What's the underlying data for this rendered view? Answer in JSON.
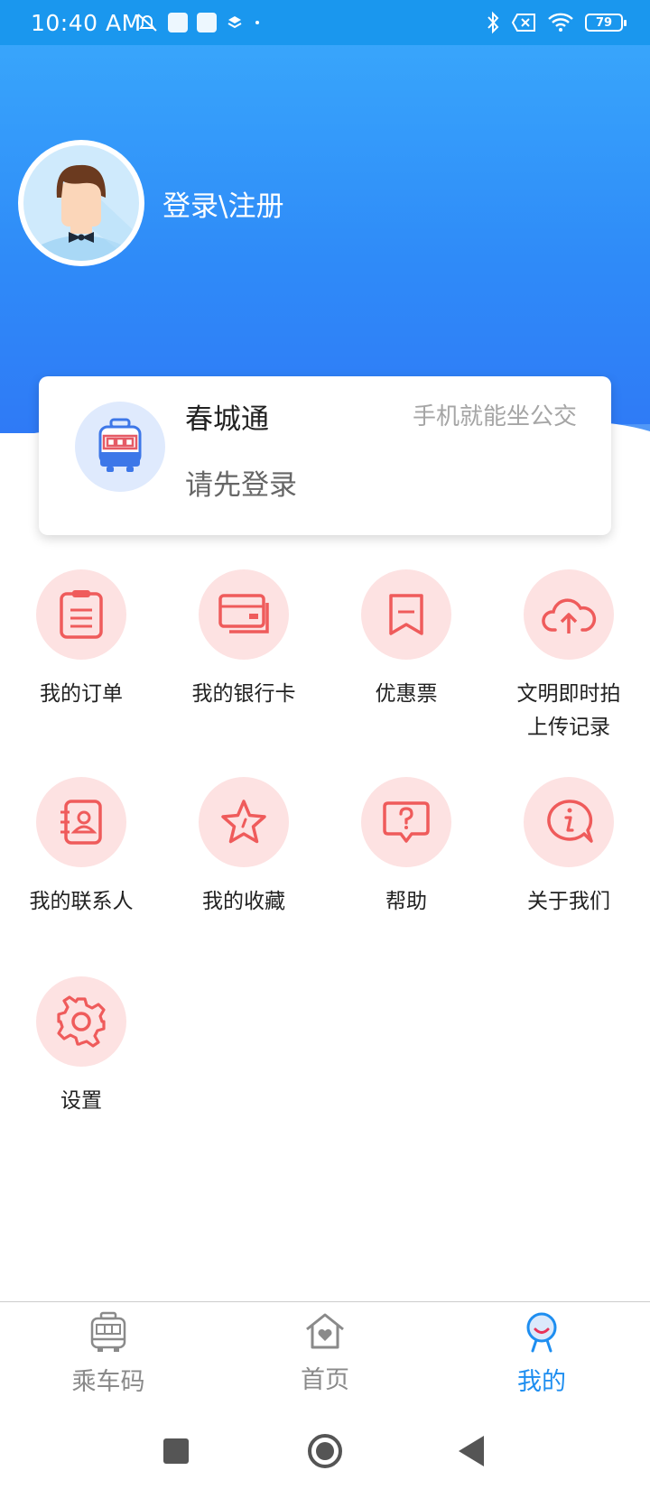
{
  "status_bar": {
    "time": "10:40 AM",
    "battery": "79"
  },
  "profile": {
    "login_label": "登录\\注册"
  },
  "card": {
    "title": "春城通",
    "slogan": "手机就能坐公交",
    "subtitle": "请先登录"
  },
  "menu": [
    {
      "label": "我的订单",
      "icon": "clipboard-icon"
    },
    {
      "label": "我的银行卡",
      "icon": "bank-card-icon"
    },
    {
      "label": "优惠票",
      "icon": "ticket-icon"
    },
    {
      "label": "文明即时拍\n上传记录",
      "icon": "cloud-upload-icon"
    },
    {
      "label": "我的联系人",
      "icon": "contacts-icon"
    },
    {
      "label": "我的收藏",
      "icon": "star-icon"
    },
    {
      "label": "帮助",
      "icon": "help-icon"
    },
    {
      "label": "关于我们",
      "icon": "info-icon"
    },
    {
      "label": "设置",
      "icon": "gear-icon"
    }
  ],
  "tabbar": {
    "tabs": [
      {
        "label": "乘车码",
        "icon": "bus-code-icon",
        "active": false
      },
      {
        "label": "首页",
        "icon": "home-icon",
        "active": false
      },
      {
        "label": "我的",
        "icon": "profile-icon",
        "active": true
      }
    ]
  },
  "colors": {
    "primary": "#1e8ef0",
    "accent_pink": "#fde2e2",
    "icon_red": "#ef5b5b"
  }
}
